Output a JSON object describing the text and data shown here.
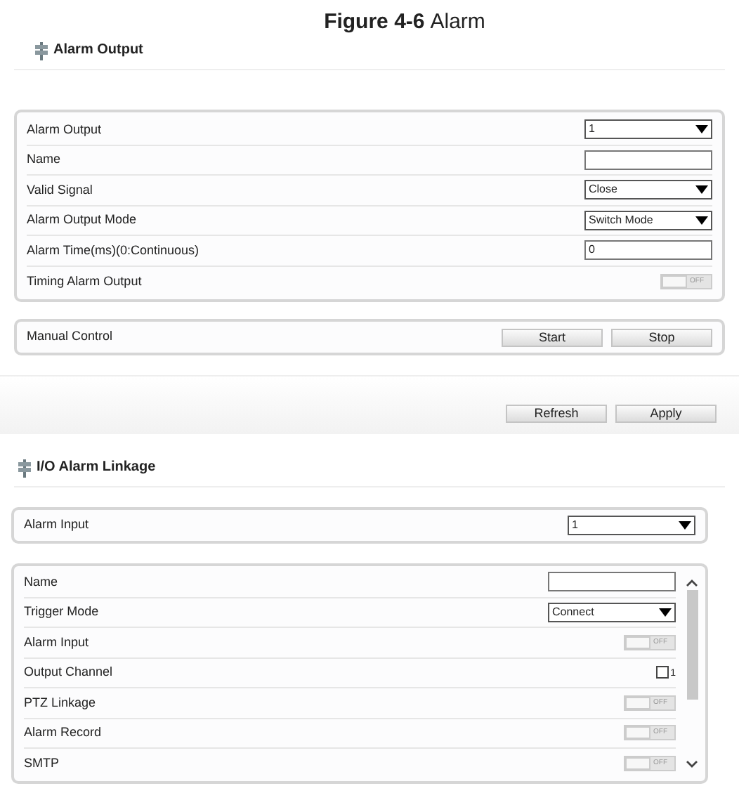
{
  "caption": {
    "number": "Figure 4-6",
    "title": "Alarm"
  },
  "alarm_output": {
    "title": "Alarm Output",
    "rows": [
      {
        "kind": "select",
        "label": "Alarm Output",
        "value": "1"
      },
      {
        "kind": "text",
        "label": "Name",
        "value": ""
      },
      {
        "kind": "select",
        "label": "Valid Signal",
        "value": "Close"
      },
      {
        "kind": "select",
        "label": "Alarm Output Mode",
        "value": "Switch Mode"
      },
      {
        "kind": "text",
        "label": "Alarm Time(ms)(0:Continuous)",
        "value": "0"
      },
      {
        "kind": "toggle",
        "label": "Timing Alarm Output",
        "on": false,
        "state_text": "OFF"
      }
    ],
    "manual_control": {
      "label": "Manual Control",
      "buttons": [
        "Start",
        "Stop"
      ]
    },
    "buttons": [
      "Refresh",
      "Apply"
    ]
  },
  "io_alarm_linkage": {
    "title": "I/O Alarm Linkage",
    "alarm_input": {
      "label": "Alarm Input",
      "value": "1"
    },
    "rows": [
      {
        "kind": "text",
        "label": "Name",
        "value": ""
      },
      {
        "kind": "select",
        "label": "Trigger Mode",
        "value": "Connect"
      },
      {
        "kind": "toggle",
        "label": "Alarm Input",
        "on": false,
        "state_text": "OFF"
      },
      {
        "kind": "checkbox",
        "label": "Output Channel",
        "checked": false,
        "option": "1"
      },
      {
        "kind": "toggle",
        "label": "PTZ Linkage",
        "on": false,
        "state_text": "OFF"
      },
      {
        "kind": "toggle",
        "label": "Alarm Record",
        "on": false,
        "state_text": "OFF"
      },
      {
        "kind": "toggle",
        "label": "SMTP",
        "on": false,
        "state_text": "OFF"
      }
    ]
  }
}
